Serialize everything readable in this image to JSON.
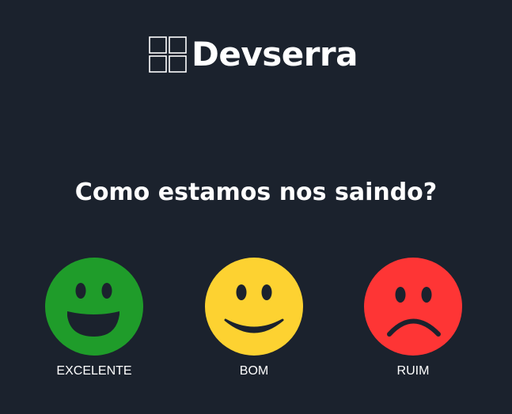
{
  "brand": {
    "name": "Devserra",
    "icon": "four-squares-grid-icon"
  },
  "survey": {
    "question": "Como estamos nos saindo?",
    "options": [
      {
        "label": "EXCELENTE",
        "icon": "big-grin-face-icon",
        "color": "#1f9c2a"
      },
      {
        "label": "BOM",
        "icon": "smiling-face-icon",
        "color": "#fdd231"
      },
      {
        "label": "RUIM",
        "icon": "frowning-face-icon",
        "color": "#fe3535"
      }
    ]
  },
  "colors": {
    "background": "#1b222d",
    "text": "#ffffff",
    "face_features": "#1b222d"
  }
}
